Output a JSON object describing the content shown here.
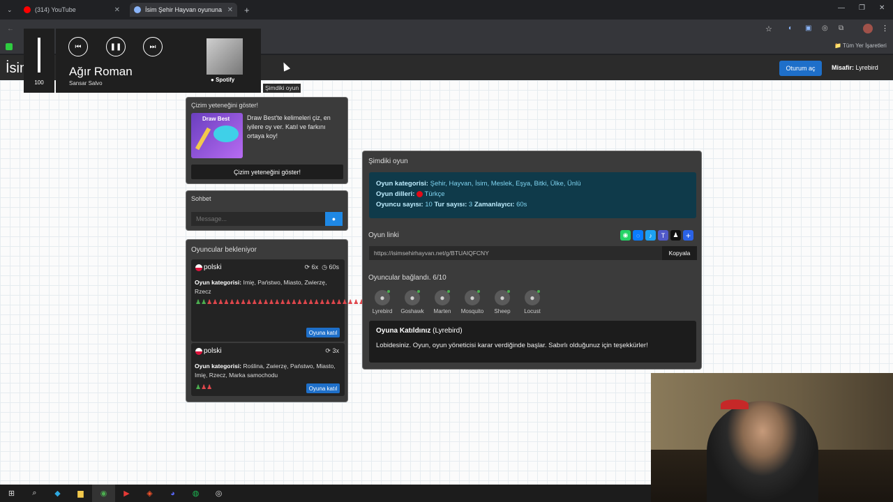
{
  "browser": {
    "tabs": [
      {
        "title": "(314) YouTube"
      },
      {
        "title": "İsim Şehir Hayvan oyununa katı"
      }
    ],
    "bookmarks_all": "Tüm Yer İşaretleri"
  },
  "header": {
    "logo": "İsim",
    "login_label": "Oturum aç",
    "guest_label": "Misafir:",
    "guest_name": "Lyrebird"
  },
  "media": {
    "volume": "100",
    "song": "Ağır Roman",
    "artist": "Sansar Salvo",
    "service": "Spotify"
  },
  "tooltip": "Şimdiki oyun",
  "draw": {
    "title": "Çizim yeteneğini göster!",
    "image_title": "Draw Best",
    "text": "Draw Best'te kelimeleri çiz, en iyilere oy ver. Katıl ve farkını ortaya koy!",
    "button": "Çizim yeteneğini göster!"
  },
  "chat": {
    "title": "Sohbet",
    "placeholder": "Message..."
  },
  "waiting": {
    "title": "Oyuncular bekleniyor",
    "lobbies": [
      {
        "name": "polski",
        "rounds": "6x",
        "timer": "60s",
        "category_label": "Oyun kategorisi:",
        "categories": "Imię, Państwo, Miasto, Zwierzę, Rzecz",
        "seats_filled": 2,
        "seats_total": 40,
        "join": "Oyuna katıl"
      },
      {
        "name": "polski",
        "rounds": "3x",
        "category_label": "Oyun kategorisi:",
        "categories": "Roślina, Zwierzę, Państwo, Miasto, Imię, Rzecz, Marka samochodu",
        "seats_filled": 1,
        "seats_total": 3,
        "join": "Oyuna katıl"
      }
    ]
  },
  "game": {
    "title": "Şimdiki oyun",
    "category_label": "Oyun kategorisi:",
    "categories": "Şehir, Hayvan, İsim, Meslek, Eşya, Bitki, Ülke, Ünlü",
    "language_label": "Oyun dilleri:",
    "language": "Türkçe",
    "players_label": "Oyuncu sayısı:",
    "players": "10",
    "rounds_label": "Tur sayısı:",
    "rounds": "3",
    "timer_label": "Zamanlayıcı:",
    "timer": "60s",
    "link_label": "Oyun linki",
    "link": "https://isimsehirhayvan.net/g/BTUAIQFCNY",
    "copy": "Kopyala",
    "connected_label": "Oyuncular bağlandı. 6/10",
    "players_list": [
      "Lyrebird",
      "Goshawk",
      "Marten",
      "Mosquito",
      "Sheep",
      "Locust"
    ],
    "joined_title": "Oyuna Katıldınız",
    "joined_name": "(Lyrebird)",
    "joined_text": "Lobidesiniz. Oyun, oyun yöneticisi karar verdiğinde başlar. Sabırlı olduğunuz için teşekkürler!"
  },
  "colors": {
    "accent": "#1e6fc9",
    "info_bg": "#0f3a4a",
    "info_text": "#7fd4f0",
    "seat_filled": "#4caf50",
    "seat_empty": "#e0474c"
  }
}
